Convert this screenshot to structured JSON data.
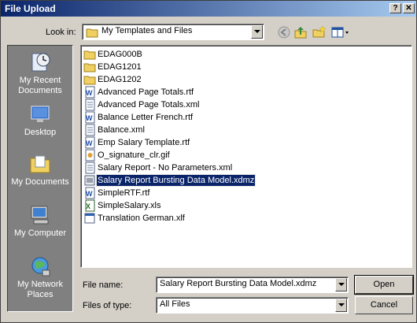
{
  "window": {
    "title": "File Upload",
    "help_label": "?",
    "close_label": "✕"
  },
  "toolbar": {
    "look_in_label": "Look in:",
    "look_in_value": "My Templates and Files"
  },
  "places": [
    {
      "label": "My Recent Documents",
      "icon": "recent-documents-icon"
    },
    {
      "label": "Desktop",
      "icon": "desktop-icon"
    },
    {
      "label": "My Documents",
      "icon": "my-documents-icon"
    },
    {
      "label": "My Computer",
      "icon": "my-computer-icon"
    },
    {
      "label": "My Network Places",
      "icon": "network-places-icon"
    }
  ],
  "files": [
    {
      "name": "EDAG000B",
      "type": "folder"
    },
    {
      "name": "EDAG1201",
      "type": "folder"
    },
    {
      "name": "EDAG1202",
      "type": "folder"
    },
    {
      "name": "Advanced Page Totals.rtf",
      "type": "rtf"
    },
    {
      "name": "Advanced Page Totals.xml",
      "type": "xml"
    },
    {
      "name": "Balance Letter French.rtf",
      "type": "rtf"
    },
    {
      "name": "Balance.xml",
      "type": "xml"
    },
    {
      "name": "Emp Salary Template.rtf",
      "type": "rtf"
    },
    {
      "name": "O_signature_clr.gif",
      "type": "gif"
    },
    {
      "name": "Salary Report - No Parameters.xml",
      "type": "xml"
    },
    {
      "name": "Salary Report Bursting Data Model.xdmz",
      "type": "xdmz",
      "selected": true
    },
    {
      "name": "SimpleRTF.rtf",
      "type": "rtf"
    },
    {
      "name": "SimpleSalary.xls",
      "type": "xls"
    },
    {
      "name": "Translation German.xlf",
      "type": "xlf"
    }
  ],
  "form": {
    "file_name_label": "File name:",
    "file_name_value": "Salary Report Bursting Data Model.xdmz",
    "file_type_label": "Files of type:",
    "file_type_value": "All Files",
    "open_label": "Open",
    "cancel_label": "Cancel"
  }
}
